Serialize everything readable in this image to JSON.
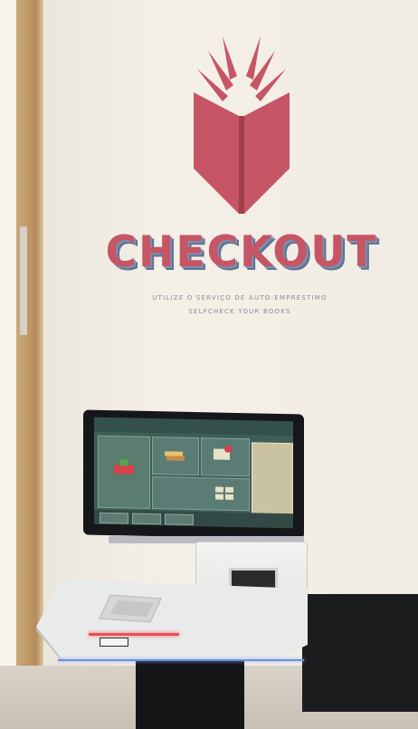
{
  "wall": {
    "title": "CHECKOUT",
    "tagline_pt": "UTILIZE O SERVIÇO DE AUTO-EMPRÉSTIMO",
    "tagline_en": "SELFCHECK YOUR BOOKS",
    "logo_icon": "open-book-icon",
    "title_color": "#c65565",
    "shadow_color": "#5f7394"
  },
  "kiosk": {
    "screen_color": "#3f5e58",
    "counter_color": "#e9eaea",
    "scanner_light_color": "#e85050",
    "edge_light_color": "#6a8fe0"
  }
}
